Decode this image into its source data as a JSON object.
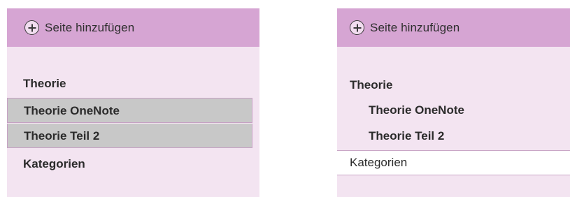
{
  "left_panel": {
    "add_page_label": "Seite hinzufügen",
    "add_page_icon": "plus-circle-icon",
    "pages": [
      {
        "label": "Theorie"
      },
      {
        "label": "Theorie OneNote"
      },
      {
        "label": "Theorie Teil 2"
      },
      {
        "label": "Kategorien"
      }
    ]
  },
  "right_panel": {
    "add_page_label": "Seite hinzufügen",
    "add_page_icon": "plus-circle-icon",
    "pages": [
      {
        "label": "Theorie"
      },
      {
        "label": "Theorie OneNote"
      },
      {
        "label": "Theorie Teil 2"
      },
      {
        "label": "Kategorien"
      }
    ]
  },
  "colors": {
    "panel_background": "#f3e4f1",
    "header_background": "#d6a5d3",
    "selection_background": "#c8c8c8",
    "active_page_background": "#ffffff",
    "border_accent": "#c9a6c6"
  }
}
